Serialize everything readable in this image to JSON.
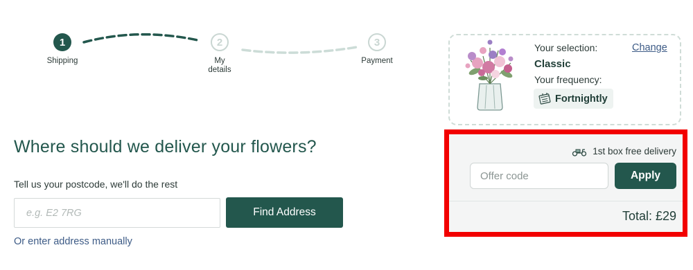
{
  "stepper": {
    "steps": [
      {
        "number": "1",
        "label": "Shipping",
        "state": "active"
      },
      {
        "number": "2",
        "label": "My details",
        "state": "inactive"
      },
      {
        "number": "3",
        "label": "Payment",
        "state": "inactive"
      }
    ],
    "colors": {
      "active": "#23574d",
      "inactive": "#c9d6d2"
    }
  },
  "delivery_form": {
    "heading": "Where should we deliver your flowers?",
    "subtext": "Tell us your postcode, we'll do the rest",
    "postcode_placeholder": "e.g. E2 7RG",
    "postcode_value": "",
    "find_button_label": "Find Address",
    "manual_link": "Or enter address manually"
  },
  "selection": {
    "selection_label": "Your selection:",
    "change_link": "Change",
    "selection_value": "Classic",
    "frequency_label": "Your frequency:",
    "frequency_value": "Fortnightly",
    "frequency_icon": "calendar-icon",
    "image_icon": "bouquet-in-vase"
  },
  "offer": {
    "delivery_note": "1st box free delivery",
    "delivery_icon": "scooter-icon",
    "code_placeholder": "Offer code",
    "code_value": "",
    "apply_label": "Apply",
    "total_text": "Total: £29"
  },
  "colors": {
    "brand_green": "#23574d",
    "link_blue": "#3d5b86",
    "highlight_red": "#f20000",
    "panel_bg": "#f4f5f5"
  }
}
